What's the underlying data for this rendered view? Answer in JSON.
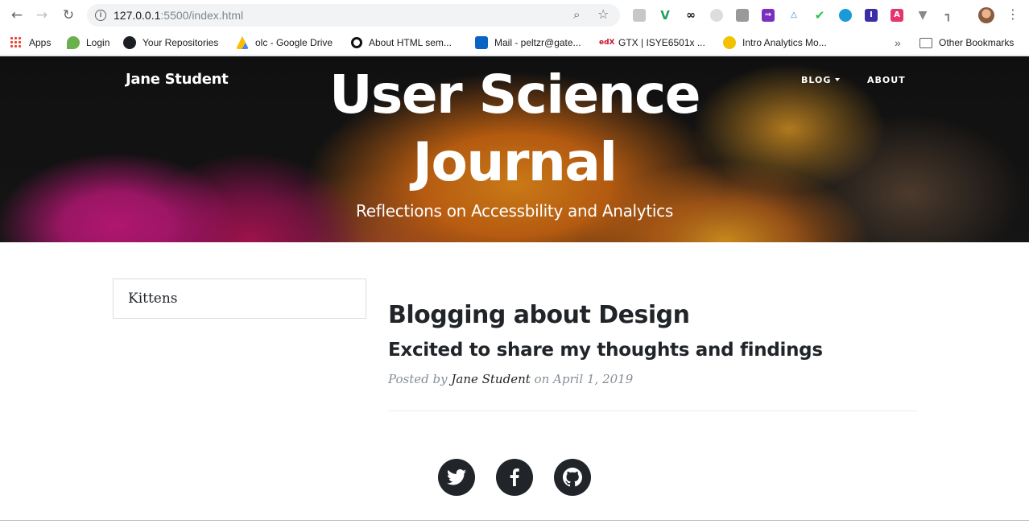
{
  "browser": {
    "url_host": "127.0.0.1",
    "url_rest": ":5500/index.html",
    "bookmarks": [
      {
        "label": "Apps"
      },
      {
        "label": "Login"
      },
      {
        "label": "Your Repositories"
      },
      {
        "label": "olc - Google Drive"
      },
      {
        "label": "About HTML sem..."
      },
      {
        "label": "Mail - peltzr@gate..."
      },
      {
        "label": "GTX | ISYE6501x ..."
      },
      {
        "label": "Intro Analytics Mo..."
      }
    ],
    "overflow": "»",
    "other_bookmarks": "Other Bookmarks"
  },
  "site": {
    "brand": "Jane Student",
    "nav": {
      "blog": "BLOG",
      "about": "ABOUT"
    },
    "title_line1": "User Science",
    "title_line2": "Journal",
    "subtitle": "Reflections on Accessbility and Analytics"
  },
  "sidebar": {
    "link": "Kittens"
  },
  "post": {
    "title": "Blogging about Design",
    "subtitle": "Excited to share my thoughts and findings",
    "posted_by": "Posted by",
    "author": "Jane Student",
    "on": "on",
    "date": "April 1, 2019"
  },
  "social": {
    "icons": [
      "twitter-icon",
      "facebook-icon",
      "github-icon"
    ],
    "color": "#212529"
  }
}
